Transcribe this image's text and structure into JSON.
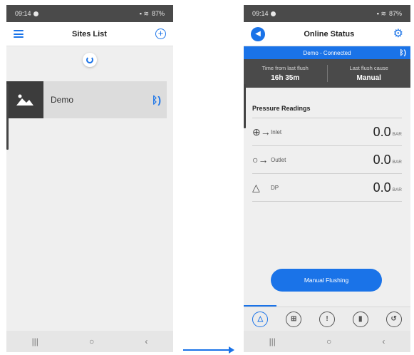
{
  "left_screen": {
    "status": {
      "time": "09:14",
      "battery": "87%"
    },
    "appbar": {
      "title": "Sites List"
    },
    "sites": [
      {
        "name": "Demo"
      }
    ],
    "icons": {
      "menu": "hamburger-menu-icon",
      "add": "add-circle-icon",
      "image": "image-placeholder-icon",
      "bluetooth": "bluetooth-icon"
    }
  },
  "right_screen": {
    "status": {
      "time": "09:14",
      "battery": "87%"
    },
    "appbar": {
      "title": "Online Status"
    },
    "connection": {
      "text": "Demo - Connected"
    },
    "flush": {
      "time_label": "Time from last flush",
      "time_value": "16h 35m",
      "cause_label": "Last flush cause",
      "cause_value": "Manual"
    },
    "pressure": {
      "title": "Pressure Readings",
      "readings": [
        {
          "label": "Inlet",
          "value": "0.0",
          "unit": "BAR"
        },
        {
          "label": "Outlet",
          "value": "0.0",
          "unit": "BAR"
        },
        {
          "label": "DP",
          "value": "0.0",
          "unit": "BAR"
        }
      ]
    },
    "action": {
      "label": "Manual Flushing"
    },
    "tabs": [
      {
        "icon": "triangle-icon",
        "glyph": "△"
      },
      {
        "icon": "grid-icon",
        "glyph": "⊞"
      },
      {
        "icon": "alert-icon",
        "glyph": "!"
      },
      {
        "icon": "signal-icon",
        "glyph": "▮"
      },
      {
        "icon": "history-icon",
        "glyph": "↺"
      }
    ]
  },
  "navbar": {
    "recent": "|||",
    "home": "○",
    "back": "‹"
  },
  "colors": {
    "accent": "#1a73e8",
    "dark_panel": "#4a4a4a"
  }
}
